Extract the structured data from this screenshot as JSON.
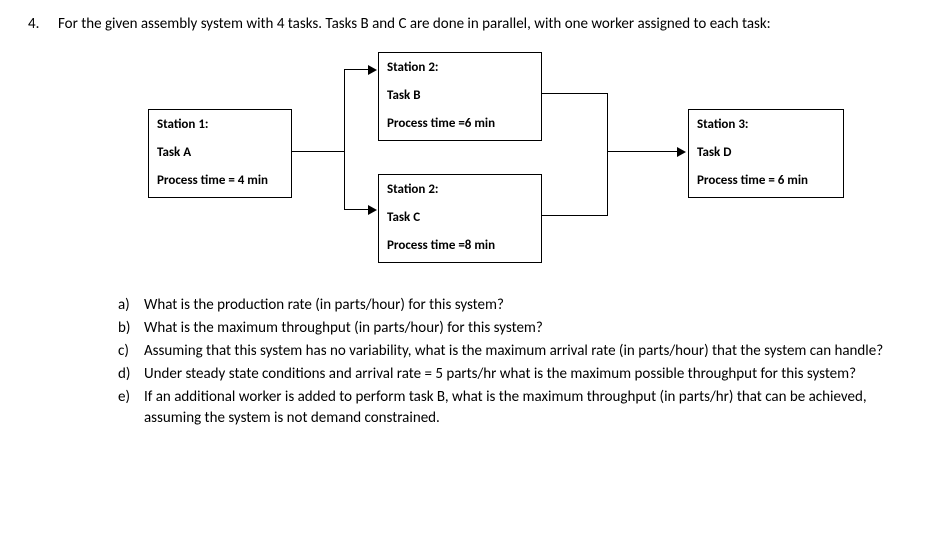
{
  "question": {
    "number": "4.",
    "intro": "For the given assembly system with 4 tasks. Tasks B and C are done in parallel, with one worker assigned to each task:"
  },
  "stations": {
    "s1": {
      "label": "Station 1:",
      "task": "Task  A",
      "pt": "Process time = 4 min"
    },
    "s2b": {
      "label": "Station 2:",
      "task": "Task B",
      "pt": "Process time =6 min"
    },
    "s2c": {
      "label": "Station 2:",
      "task": "Task C",
      "pt": "Process time =8 min"
    },
    "s3": {
      "label": "Station 3:",
      "task": "Task D",
      "pt": "Process time = 6 min"
    }
  },
  "subq": {
    "a": {
      "letter": "a)",
      "text": "What is the production rate (in parts/hour) for this system?"
    },
    "b": {
      "letter": "b)",
      "text": "What is the maximum throughput (in parts/hour) for this system?"
    },
    "c": {
      "letter": "c)",
      "text": "Assuming that this system has no variability, what is the maximum arrival rate (in parts/hour) that the system can handle?"
    },
    "d": {
      "letter": "d)",
      "text": "Under steady state conditions and arrival rate = 5 parts/hr what is the maximum possible throughput for this system?"
    },
    "e": {
      "letter": "e)",
      "text": "If an additional worker is added to perform task B, what is the maximum throughput (in parts/hr) that can be achieved, assuming the system is not demand constrained."
    }
  }
}
